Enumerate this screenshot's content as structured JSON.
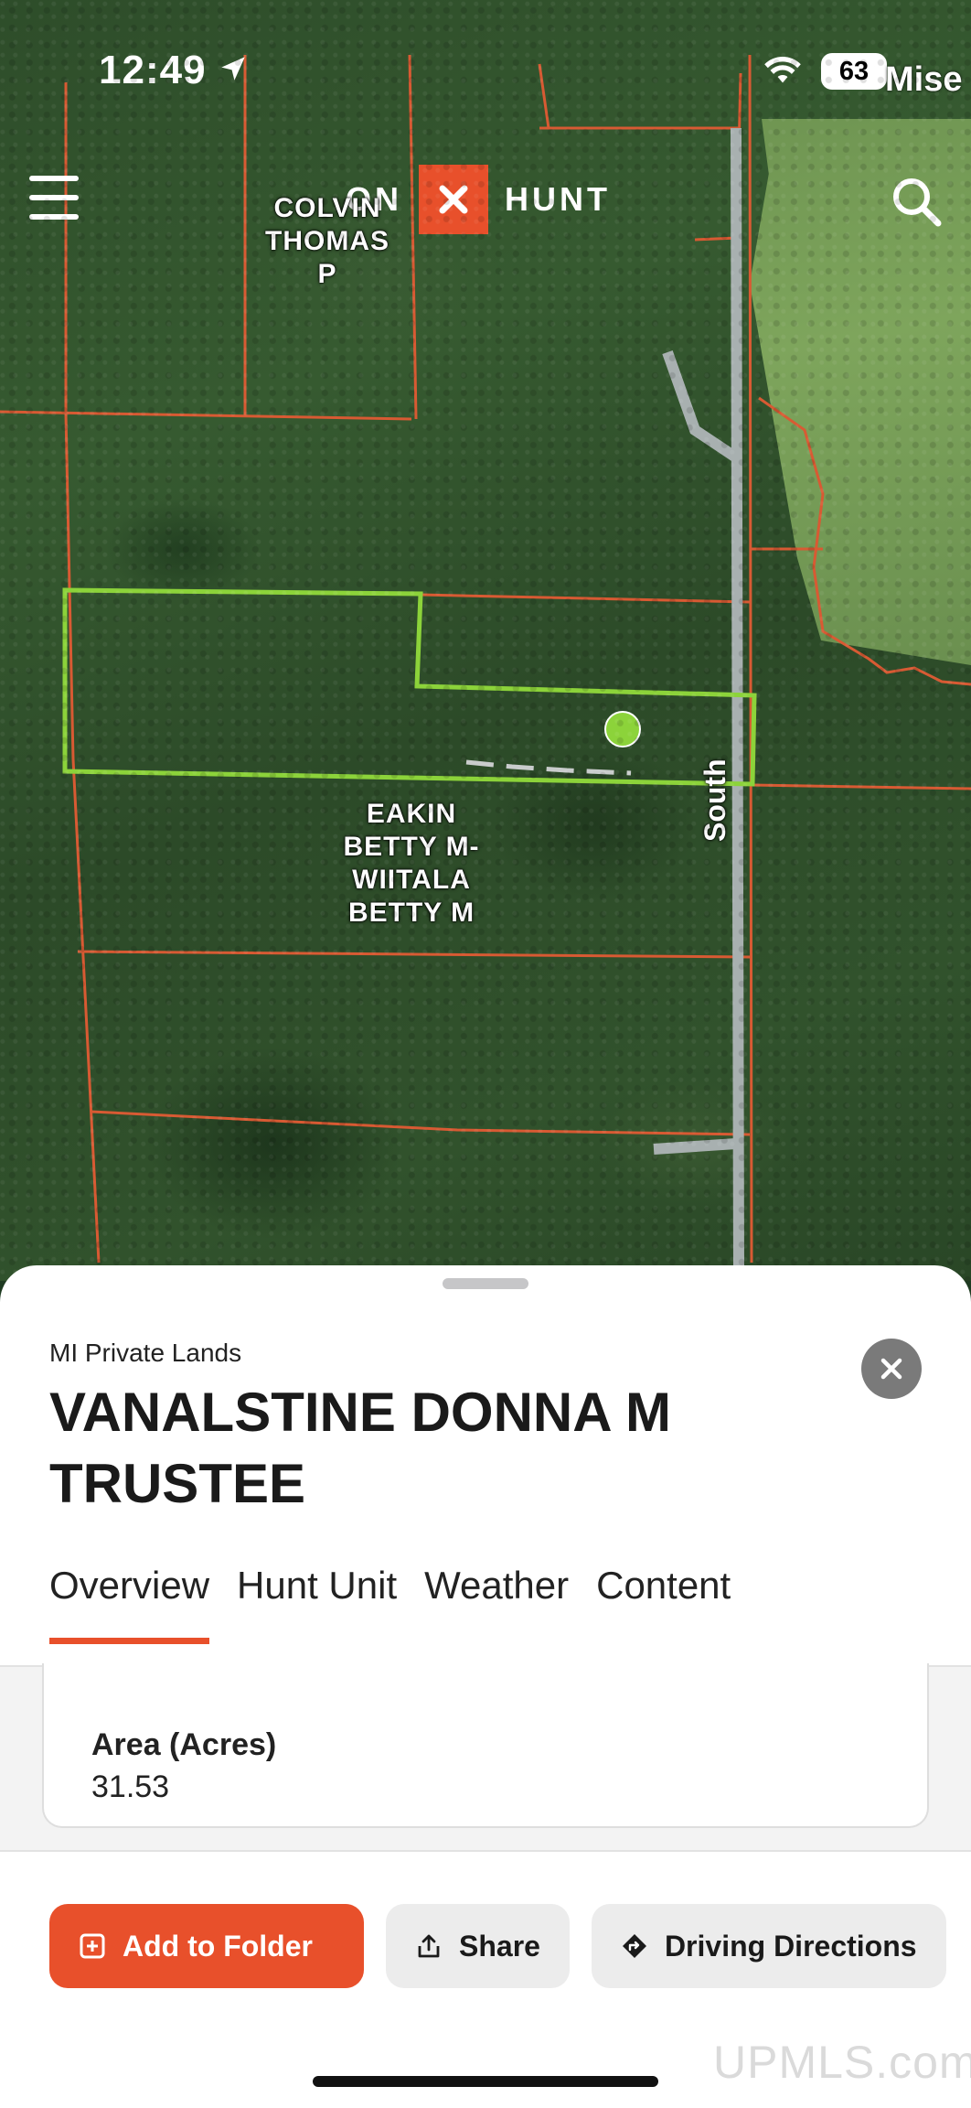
{
  "status": {
    "time": "12:49",
    "battery": "63",
    "place_label": "Mise"
  },
  "header": {
    "logo_left": "ON",
    "logo_right": "HUNT"
  },
  "map": {
    "parcel_label_1": [
      "COLVIN",
      "THOMAS",
      "P"
    ],
    "parcel_label_2": [
      "EAKIN",
      "BETTY M-",
      "WIITALA",
      "BETTY M"
    ],
    "road_label": "South"
  },
  "sheet": {
    "subtitle": "MI Private Lands",
    "title": "VANALSTINE DONNA M TRUSTEE",
    "tabs": [
      {
        "label": "Overview",
        "active": true
      },
      {
        "label": "Hunt Unit",
        "active": false
      },
      {
        "label": "Weather",
        "active": false
      },
      {
        "label": "Content",
        "active": false
      }
    ],
    "field": {
      "label": "Area (Acres)",
      "value": "31.53"
    },
    "actions": {
      "add_folder": "Add to Folder",
      "share": "Share",
      "directions": "Driving Directions"
    }
  },
  "watermark": "UPMLS.com",
  "colors": {
    "accent": "#e8502b",
    "parcel_highlight": "#8cd33a",
    "boundary": "#d85a33"
  }
}
